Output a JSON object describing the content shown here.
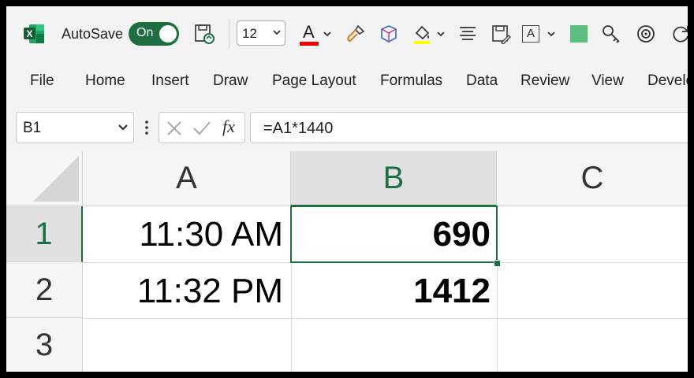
{
  "app": {
    "autosave_label": "AutoSave",
    "autosave_state": "On",
    "font_size": "12",
    "font_color_letter": "A",
    "brand_color": "#1d6f42"
  },
  "icons": [
    "excel-logo-icon",
    "save-sync-icon",
    "font-size-chevron-down-icon",
    "font-color-icon",
    "format-painter-icon",
    "3d-box-icon",
    "fill-color-icon",
    "align-icon",
    "save-form-icon",
    "text-box-icon",
    "green-square-icon",
    "key-icon",
    "target-icon",
    "refresh-icon"
  ],
  "ribbon": {
    "tabs": [
      "File",
      "Home",
      "Insert",
      "Draw",
      "Page Layout",
      "Formulas",
      "Data",
      "Review",
      "View",
      "Develo"
    ]
  },
  "formula_bar": {
    "name_box": "B1",
    "fx": "fx",
    "formula": "=A1*1440"
  },
  "sheet": {
    "columns": [
      "A",
      "B",
      "C"
    ],
    "rows": [
      "1",
      "2",
      "3"
    ],
    "selected_cell": "B1",
    "cells": {
      "A1": "11:30 AM",
      "B1": "690",
      "A2": "11:32 PM",
      "B2": "1412"
    }
  }
}
